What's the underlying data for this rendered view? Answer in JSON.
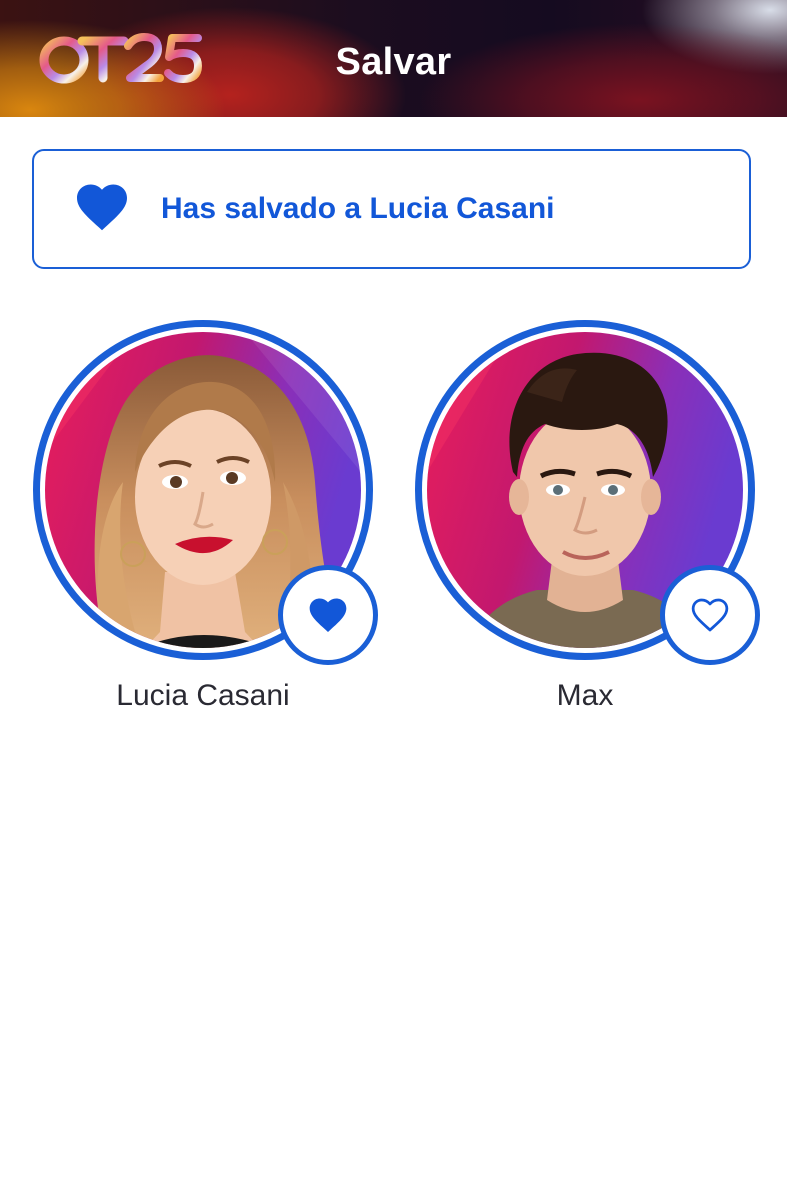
{
  "header": {
    "logo_text": "OT25",
    "title": "Salvar"
  },
  "banner": {
    "icon": "heart-filled-icon",
    "text": "Has salvado a Lucia Casani"
  },
  "contestants": [
    {
      "name": "Lucia Casani",
      "saved": true,
      "save_icon": "heart-filled-icon"
    },
    {
      "name": "Max",
      "saved": false,
      "save_icon": "heart-outline-icon"
    }
  ],
  "colors": {
    "accent": "#1a5fd6",
    "banner_text": "#1257d8",
    "name_text": "#2a2a33",
    "header_title": "#ffffff",
    "page_bg": "#ffffff"
  }
}
